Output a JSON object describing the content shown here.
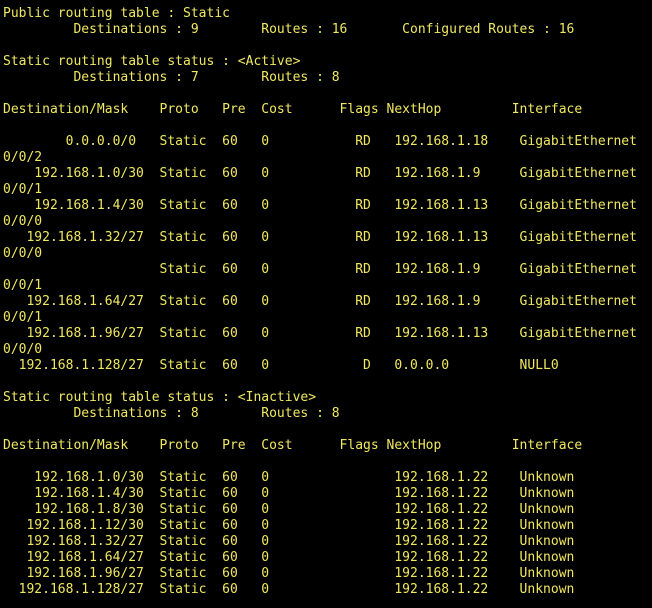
{
  "terminal": {
    "lines": [
      "Public routing table : Static",
      "         Destinations : 9        Routes : 16       Configured Routes : 16",
      "",
      "Static routing table status : <Active>",
      "         Destinations : 7        Routes : 8",
      "",
      "Destination/Mask    Proto   Pre  Cost      Flags NextHop         Interface",
      "",
      "        0.0.0.0/0   Static  60   0           RD   192.168.1.18    GigabitEthernet",
      "0/0/2",
      "    192.168.1.0/30  Static  60   0           RD   192.168.1.9     GigabitEthernet",
      "0/0/1",
      "    192.168.1.4/30  Static  60   0           RD   192.168.1.13    GigabitEthernet",
      "0/0/0",
      "   192.168.1.32/27  Static  60   0           RD   192.168.1.13    GigabitEthernet",
      "0/0/0",
      "                    Static  60   0           RD   192.168.1.9     GigabitEthernet",
      "0/0/1",
      "   192.168.1.64/27  Static  60   0           RD   192.168.1.9     GigabitEthernet",
      "0/0/1",
      "   192.168.1.96/27  Static  60   0           RD   192.168.1.13    GigabitEthernet",
      "0/0/0",
      "  192.168.1.128/27  Static  60   0            D   0.0.0.0         NULL0",
      "",
      "Static routing table status : <Inactive>",
      "         Destinations : 8        Routes : 8",
      "",
      "Destination/Mask    Proto   Pre  Cost      Flags NextHop         Interface",
      "",
      "    192.168.1.0/30  Static  60   0                192.168.1.22    Unknown",
      "    192.168.1.4/30  Static  60   0                192.168.1.22    Unknown",
      "    192.168.1.8/30  Static  60   0                192.168.1.22    Unknown",
      "   192.168.1.12/30  Static  60   0                192.168.1.22    Unknown",
      "   192.168.1.32/27  Static  60   0                192.168.1.22    Unknown",
      "   192.168.1.64/27  Static  60   0                192.168.1.22    Unknown",
      "   192.168.1.96/27  Static  60   0                192.168.1.22    Unknown",
      "  192.168.1.128/27  Static  60   0                192.168.1.22    Unknown"
    ]
  },
  "colors": {
    "background": "#000000",
    "text": "#f0e860"
  }
}
